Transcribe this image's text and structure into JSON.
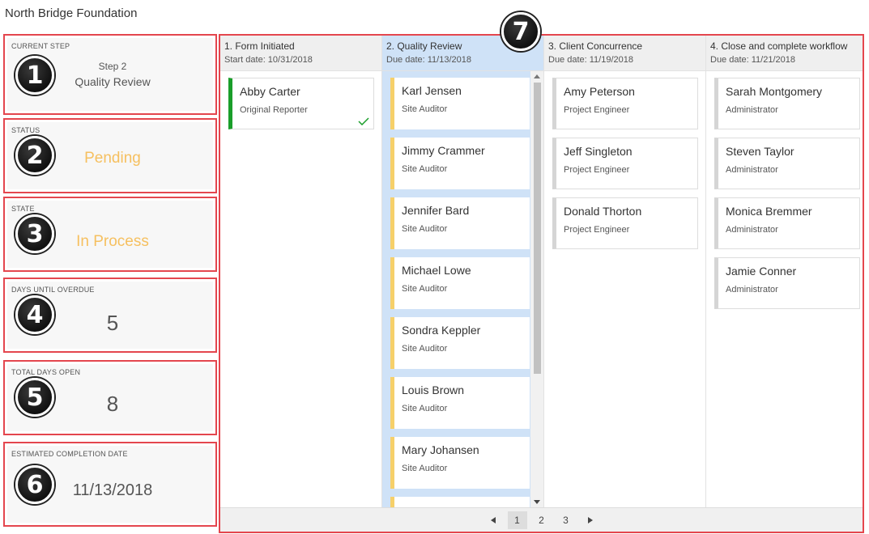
{
  "app": {
    "title": "North Bridge Foundation"
  },
  "badges": [
    "1",
    "2",
    "3",
    "4",
    "5",
    "6",
    "7"
  ],
  "panels": {
    "current_step": {
      "label": "CURRENT STEP",
      "step": "Step 2",
      "name": "Quality Review"
    },
    "status": {
      "label": "STATUS",
      "value": "Pending"
    },
    "state": {
      "label": "STATE",
      "value": "In Process"
    },
    "days_until_overdue": {
      "label": "DAYS UNTIL OVERDUE",
      "value": "5"
    },
    "total_days_open": {
      "label": "TOTAL DAYS OPEN",
      "value": "8"
    },
    "estimated_completion": {
      "label": "ESTIMATED COMPLETION DATE",
      "value": "11/13/2018"
    }
  },
  "columns": [
    {
      "title": "1. Form Initiated",
      "date": "Start date:  10/31/2018",
      "cards": [
        {
          "name": "Abby Carter",
          "role": "Original Reporter"
        }
      ]
    },
    {
      "title": "2. Quality Review",
      "date": "Due date:  11/13/2018",
      "cards": [
        {
          "name": "Karl Jensen",
          "role": "Site Auditor"
        },
        {
          "name": "Jimmy Crammer",
          "role": "Site Auditor"
        },
        {
          "name": "Jennifer Bard",
          "role": "Site Auditor"
        },
        {
          "name": "Michael Lowe",
          "role": "Site Auditor"
        },
        {
          "name": "Sondra Keppler",
          "role": "Site Auditor"
        },
        {
          "name": "Louis Brown",
          "role": "Site Auditor"
        },
        {
          "name": "Mary Johansen",
          "role": "Site Auditor"
        }
      ]
    },
    {
      "title": "3. Client Concurrence",
      "date": "Due date:  11/19/2018",
      "cards": [
        {
          "name": "Amy Peterson",
          "role": "Project Engineer"
        },
        {
          "name": "Jeff Singleton",
          "role": "Project Engineer"
        },
        {
          "name": "Donald Thorton",
          "role": "Project Engineer"
        }
      ]
    },
    {
      "title": "4. Close and complete workflow",
      "date": "Due date:  11/21/2018",
      "cards": [
        {
          "name": "Sarah Montgomery",
          "role": "Administrator"
        },
        {
          "name": "Steven Taylor",
          "role": "Administrator"
        },
        {
          "name": "Monica Bremmer",
          "role": "Administrator"
        },
        {
          "name": "Jamie Conner",
          "role": "Administrator"
        }
      ]
    }
  ],
  "pager": {
    "pages": [
      "1",
      "2",
      "3"
    ],
    "current": "1"
  },
  "colors": {
    "highlight": "#e4464e",
    "active_column": "#cfe2f7",
    "status_orange": "#f6c060",
    "complete_green": "#1a9e2a",
    "pending_yellow": "#f6d06a"
  }
}
